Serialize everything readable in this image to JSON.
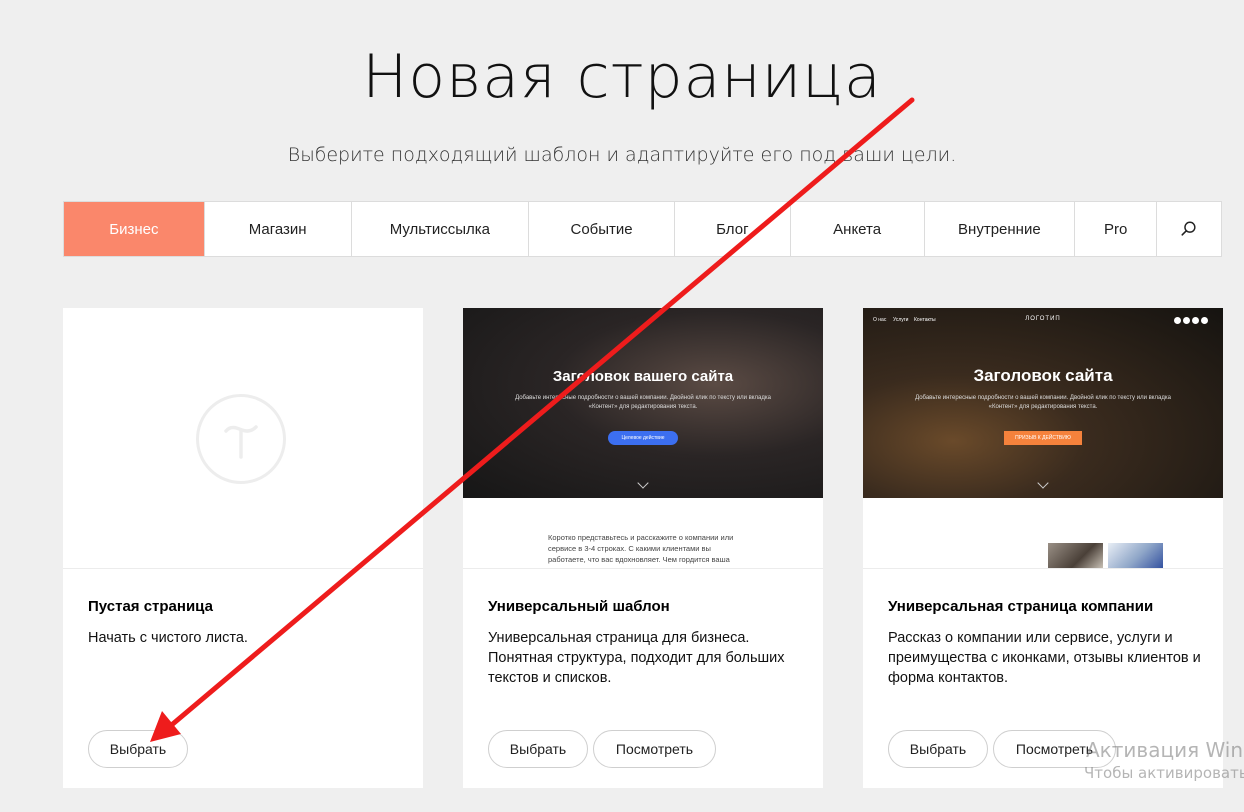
{
  "header": {
    "title": "Новая страница",
    "subtitle": "Выберите подходящий шаблон и адаптируйте его под ваши цели."
  },
  "tabs": [
    {
      "label": "Бизнес",
      "active": true
    },
    {
      "label": "Магазин",
      "active": false
    },
    {
      "label": "Мультиссылка",
      "active": false
    },
    {
      "label": "Событие",
      "active": false
    },
    {
      "label": "Блог",
      "active": false
    },
    {
      "label": "Анкета",
      "active": false
    },
    {
      "label": "Внутренние",
      "active": false
    },
    {
      "label": "Pro",
      "active": false
    }
  ],
  "search_icon": "search-icon",
  "colors": {
    "active_tab": "#fa876b",
    "page_bg": "#efefef",
    "arrow": "#ee1c1c",
    "preview_button_blue": "#3c6ff0",
    "preview_button_orange": "#f5823c"
  },
  "cards": [
    {
      "title": "Пустая страница",
      "description": "Начать с чистого листа.",
      "select_label": "Выбрать"
    },
    {
      "title": "Универсальный шаблон",
      "description": "Универсальная страница для бизнеса. Понятная структура, подходит для больших текстов и списков.",
      "select_label": "Выбрать",
      "preview_label": "Посмотреть",
      "preview": {
        "heading": "Заголовок вашего сайта",
        "text": "Добавьте интересные подробности о вашей компании. Двойной клик по тексту или вкладка «Контент» для редактирования текста.",
        "button": "Целевое действие",
        "body": "Коротко представьтесь и расскажите о компании или сервисе в 3-4 строках. С какими клиентами вы работаете, что вас вдохновляет. Чем гордится ваша команда, какие у нее ценности и мотивация"
      }
    },
    {
      "title": "Универсальная страница компании",
      "description": "Рассказ о компании или сервисе, услуги и преимущества с иконками, отзывы клиентов и форма контактов.",
      "select_label": "Выбрать",
      "preview_label": "Посмотреть",
      "preview": {
        "nav": [
          "О нас",
          "Услуги",
          "Контакты"
        ],
        "logo": "ЛОГОТИП",
        "heading": "Заголовок сайта",
        "text": "Добавьте интересные подробности о вашей компании. Двойной клик по тексту или вкладка «Контент» для редактирования текста.",
        "button": "ПРИЗЫВ К ДЕЙСТВИЮ"
      }
    }
  ],
  "watermark": {
    "line1": "Активация Windo",
    "line2": "Чтобы активировать Win"
  }
}
